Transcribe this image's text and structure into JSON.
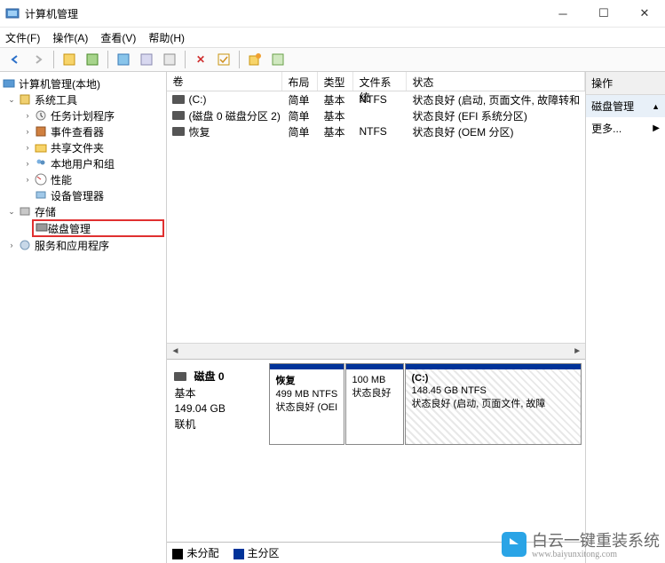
{
  "window": {
    "title": "计算机管理"
  },
  "menu": {
    "file": "文件(F)",
    "action": "操作(A)",
    "view": "查看(V)",
    "help": "帮助(H)"
  },
  "tree": {
    "root": "计算机管理(本地)",
    "systools": "系统工具",
    "tasksched": "任务计划程序",
    "eventvwr": "事件查看器",
    "sharedfolders": "共享文件夹",
    "localusers": "本地用户和组",
    "performance": "性能",
    "devmgr": "设备管理器",
    "storage": "存储",
    "diskmgmt": "磁盘管理",
    "services": "服务和应用程序"
  },
  "volTable": {
    "headers": {
      "volume": "卷",
      "layout": "布局",
      "type": "类型",
      "filesystem": "文件系统",
      "status": "状态"
    },
    "rows": [
      {
        "volume": "(C:)",
        "layout": "简单",
        "type": "基本",
        "fs": "NTFS",
        "status": "状态良好 (启动, 页面文件, 故障转和"
      },
      {
        "volume": "(磁盘 0 磁盘分区 2)",
        "layout": "简单",
        "type": "基本",
        "fs": "",
        "status": "状态良好 (EFI 系统分区)"
      },
      {
        "volume": "恢复",
        "layout": "简单",
        "type": "基本",
        "fs": "NTFS",
        "status": "状态良好 (OEM 分区)"
      }
    ]
  },
  "disk": {
    "name": "磁盘 0",
    "type": "基本",
    "size": "149.04 GB",
    "state": "联机",
    "parts": [
      {
        "title": "恢复",
        "size": "499 MB NTFS",
        "status": "状态良好 (OEI"
      },
      {
        "title": "",
        "size": "100 MB",
        "status": "状态良好"
      },
      {
        "title": "(C:)",
        "size": "148.45 GB NTFS",
        "status": "状态良好 (启动, 页面文件, 故障"
      }
    ]
  },
  "legend": {
    "unalloc": "未分配",
    "primary": "主分区"
  },
  "actions": {
    "header": "操作",
    "diskmgmt": "磁盘管理",
    "more": "更多..."
  },
  "watermark": {
    "text": "白云一键重装系统",
    "url": "www.baiyunxitong.com"
  }
}
